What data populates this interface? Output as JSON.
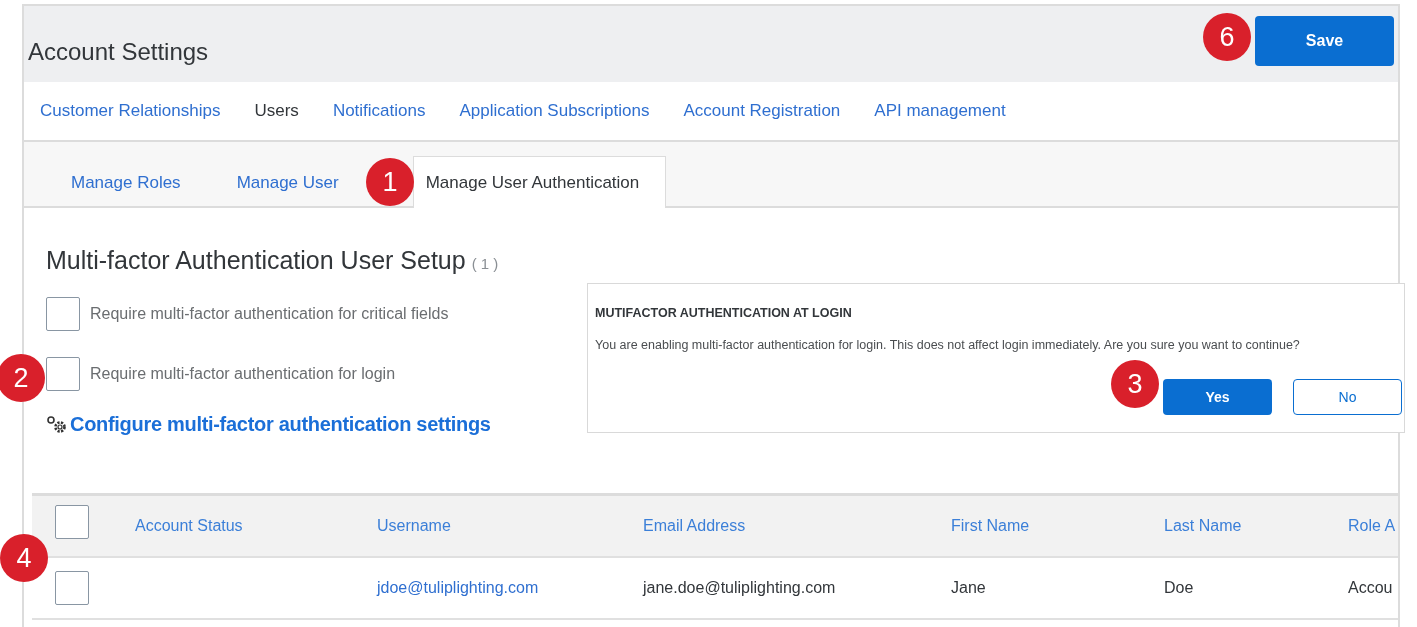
{
  "header": {
    "title": "Account Settings",
    "save_button": "Save"
  },
  "nav_tabs": [
    {
      "label": "Customer Relationships",
      "selected": false
    },
    {
      "label": "Users",
      "selected": true
    },
    {
      "label": "Notifications",
      "selected": false
    },
    {
      "label": "Application Subscriptions",
      "selected": false
    },
    {
      "label": "Account Registration",
      "selected": false
    },
    {
      "label": "API management",
      "selected": false
    }
  ],
  "sub_tabs": [
    {
      "label": "Manage Roles",
      "selected": false
    },
    {
      "label": "Manage User",
      "selected": false
    },
    {
      "label": "Manage User Authentication",
      "selected": true
    }
  ],
  "section": {
    "title": "Multi-factor Authentication User Setup",
    "count": "( 1 )",
    "options": [
      {
        "label": "Require multi-factor authentication for critical fields",
        "checked": false
      },
      {
        "label": "Require multi-factor authentication for login",
        "checked": false
      }
    ],
    "config_link": "Configure multi-factor authentication settings"
  },
  "dialog": {
    "title": "MUTIFACTOR AUTHENTICATION AT LOGIN",
    "message": "You are enabling multi-factor authentication for login. This does not affect login immediately. Are you sure you want to continue?",
    "buttons": [
      {
        "label": "Yes",
        "kind": "primary"
      },
      {
        "label": "No",
        "kind": "secondary"
      }
    ]
  },
  "table": {
    "select_all_checked": false,
    "columns": [
      "Account Status",
      "Username",
      "Email Address",
      "First Name",
      "Last Name",
      "Role A"
    ],
    "rows": [
      {
        "checked": false,
        "username": "jdoe@tuliplighting.com",
        "email_address": "jane.doe@tuliplighting.com",
        "first_name": "Jane",
        "last_name": "Doe",
        "column_6": "Accou"
      }
    ]
  },
  "callouts": [
    "1",
    "2",
    "3",
    "4",
    "6"
  ]
}
